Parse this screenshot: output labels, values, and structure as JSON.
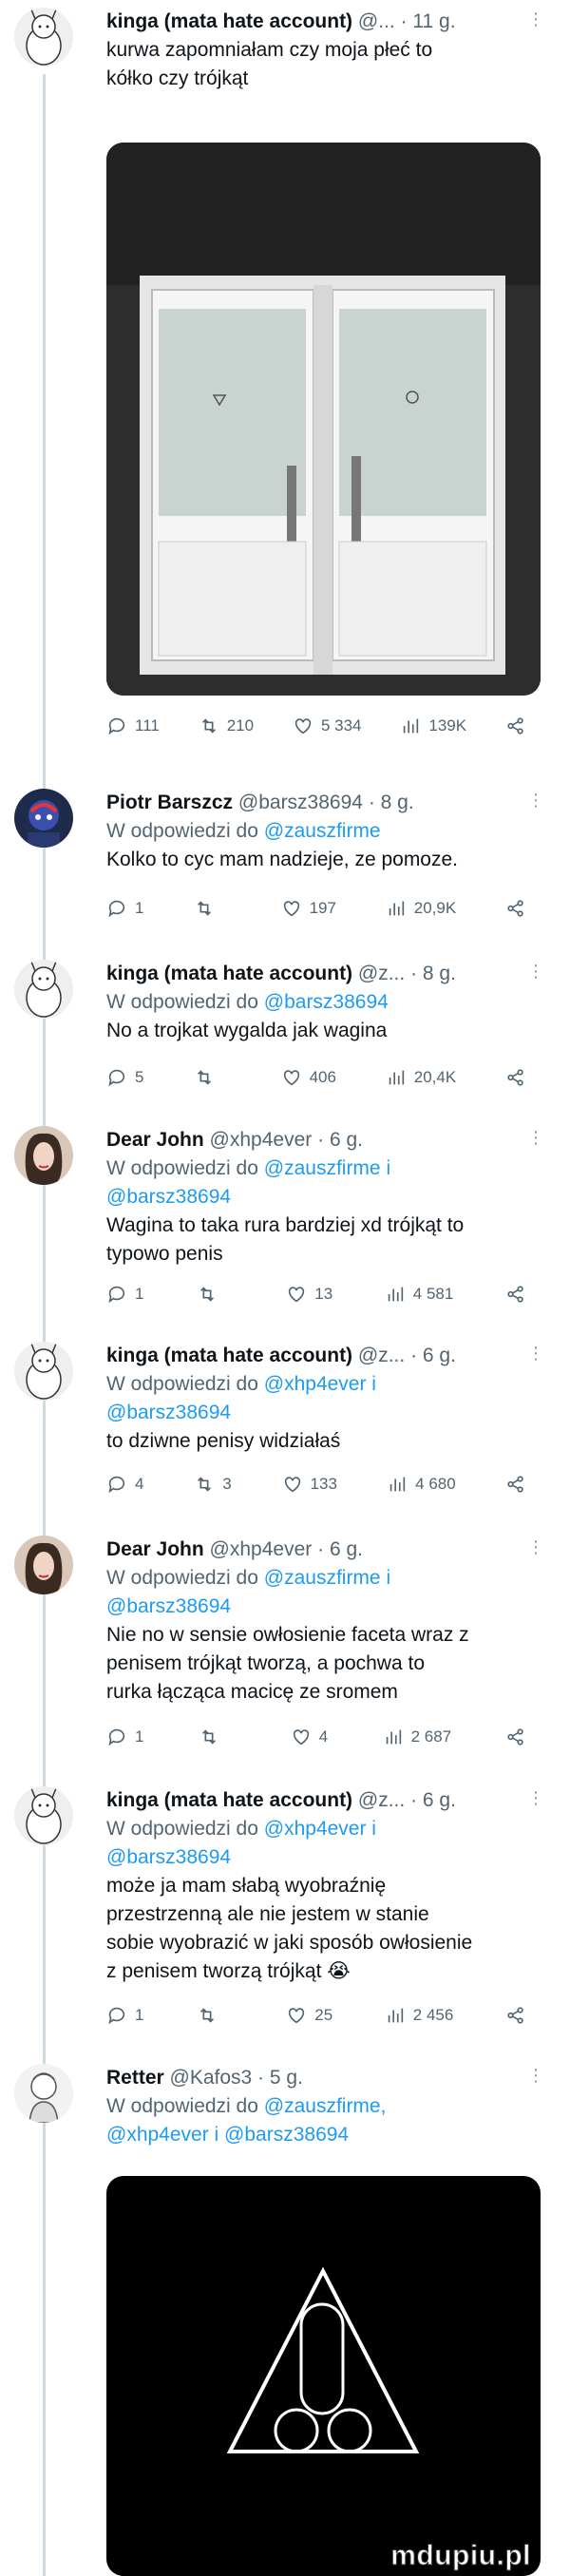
{
  "tweets": [
    {
      "name": "kinga (mata hate account)",
      "handle": "@...",
      "time": "11 g.",
      "text": [
        "kurwa zapomniałam czy moja płeć to",
        "kółko czy trójkąt"
      ],
      "stats": {
        "replies": "111",
        "retweets": "210",
        "likes": "5 334",
        "views": "139K"
      }
    },
    {
      "name": "Piotr Barszcz",
      "handle": "@barsz38694",
      "time": "8 g.",
      "reply_prefix": "W odpowiedzi do",
      "reply_to": [
        "@zauszfirme"
      ],
      "text": [
        "Kolko to cyc mam nadzieje, ze pomoze."
      ],
      "stats": {
        "replies": "1",
        "retweets": "",
        "likes": "197",
        "views": "20,9K"
      }
    },
    {
      "name": "kinga (mata hate account)",
      "handle": "@z...",
      "time": "8 g.",
      "reply_prefix": "W odpowiedzi do",
      "reply_to": [
        "@barsz38694"
      ],
      "text": [
        "No a trojkat wygalda jak wagina"
      ],
      "stats": {
        "replies": "5",
        "retweets": "",
        "likes": "406",
        "views": "20,4K"
      }
    },
    {
      "name": "Dear John",
      "handle": "@xhp4ever",
      "time": "6 g.",
      "reply_prefix": "W odpowiedzi do",
      "reply_to": [
        "@zauszfirme i",
        "@barsz38694"
      ],
      "text": [
        "Wagina to taka rura bardziej xd trójkąt to",
        "typowo penis"
      ],
      "stats": {
        "replies": "1",
        "retweets": "",
        "likes": "13",
        "views": "4 581"
      }
    },
    {
      "name": "kinga (mata hate account)",
      "handle": "@z...",
      "time": "6 g.",
      "reply_prefix": "W odpowiedzi do",
      "reply_to": [
        "@xhp4ever i",
        "@barsz38694"
      ],
      "text": [
        "to dziwne penisy widziałaś"
      ],
      "stats": {
        "replies": "4",
        "retweets": "3",
        "likes": "133",
        "views": "4 680"
      }
    },
    {
      "name": "Dear John",
      "handle": "@xhp4ever",
      "time": "6 g.",
      "reply_prefix": "W odpowiedzi do",
      "reply_to": [
        "@zauszfirme i",
        "@barsz38694"
      ],
      "text": [
        "Nie no w sensie owłosienie faceta wraz z",
        "penisem trójkąt tworzą, a pochwa to",
        "rurka łącząca macicę ze sromem"
      ],
      "stats": {
        "replies": "1",
        "retweets": "",
        "likes": "4",
        "views": "2 687"
      }
    },
    {
      "name": "kinga (mata hate account)",
      "handle": "@z...",
      "time": "6 g.",
      "reply_prefix": "W odpowiedzi do",
      "reply_to": [
        "@xhp4ever i",
        "@barsz38694"
      ],
      "text": [
        "może ja mam słabą wyobraźnię",
        "przestrzenną ale nie jestem w stanie",
        "sobie wyobrazić w jaki sposób owłosienie",
        "z penisem tworzą trójkąt 😭"
      ],
      "stats": {
        "replies": "1",
        "retweets": "",
        "likes": "25",
        "views": "2 456"
      }
    },
    {
      "name": "Retter",
      "handle": "@Kafos3",
      "time": "5 g.",
      "reply_prefix": "W odpowiedzi do",
      "reply_to": [
        "@zauszfirme,",
        "@xhp4ever i @barsz38694"
      ],
      "text": []
    }
  ],
  "watermark": "mdupiu.pl",
  "colors": {
    "accent": "#1d9bf0",
    "muted": "#536471",
    "line": "#cfd9de"
  }
}
